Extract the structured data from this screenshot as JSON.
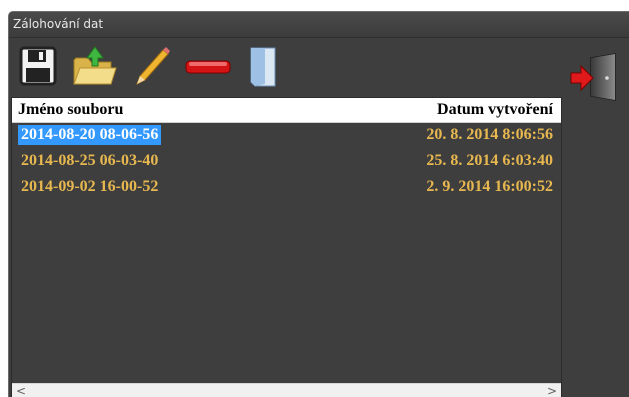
{
  "window": {
    "title": "Zálohování dat"
  },
  "toolbar": {
    "buttons": [
      {
        "icon": "floppy-disk-icon"
      },
      {
        "icon": "open-folder-upload-icon"
      },
      {
        "icon": "pencil-icon"
      },
      {
        "icon": "red-minus-icon"
      },
      {
        "icon": "blank-document-icon"
      }
    ],
    "exit_icon": "exit-door-icon"
  },
  "list": {
    "columns": [
      "Jméno souboru",
      "Datum vytvoření"
    ],
    "rows": [
      {
        "name": "2014-08-20 08-06-56",
        "date": "20. 8. 2014 8:06:56",
        "selected": true
      },
      {
        "name": "2014-08-25 06-03-40",
        "date": "25. 8. 2014 6:03:40",
        "selected": false
      },
      {
        "name": "2014-09-02 16-00-52",
        "date": "2. 9. 2014 16:00:52",
        "selected": false
      }
    ]
  },
  "scrollbar": {
    "left_arrow": "<",
    "right_arrow": ">"
  },
  "colors": {
    "background": "#3e3e3e",
    "row_text": "#e8b850",
    "selection": "#3399ff",
    "header_bg": "#ffffff"
  }
}
